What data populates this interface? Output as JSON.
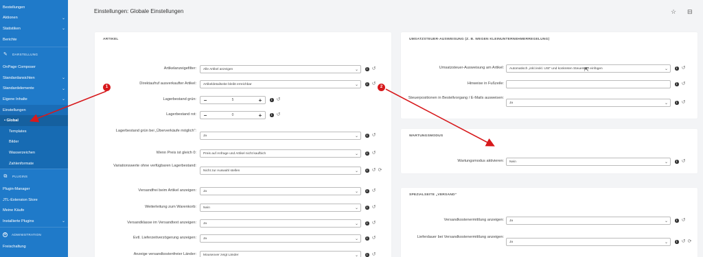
{
  "sidebar": {
    "items": [
      {
        "label": "Bestellungen",
        "chevron": false
      },
      {
        "label": "Aktionen",
        "chevron": true
      },
      {
        "label": "Statistiken",
        "chevron": true
      },
      {
        "label": "Berichte",
        "chevron": false
      }
    ],
    "section_darstellung": "DARSTELLUNG",
    "darstellung_items": [
      {
        "label": "OnPage Composer",
        "chevron": false
      },
      {
        "label": "Standardansichten",
        "chevron": true
      },
      {
        "label": "Standardelemente",
        "chevron": true
      },
      {
        "label": "Eigene Inhalte",
        "chevron": true
      },
      {
        "label": "Einstellungen",
        "chevron": false
      }
    ],
    "einstellungen_sub": [
      {
        "label": "• Global",
        "active": true
      },
      {
        "label": "Templates",
        "active": false
      },
      {
        "label": "Bilder",
        "active": false
      },
      {
        "label": "Wasserzeichen",
        "active": false
      },
      {
        "label": "Zahlenformate",
        "active": false
      }
    ],
    "section_plugins": "PLUGINS",
    "plugin_items": [
      {
        "label": "Plugin-Manager",
        "chevron": false
      },
      {
        "label": "JTL-Extension Store",
        "chevron": false
      },
      {
        "label": "Meine Käufe",
        "chevron": false
      },
      {
        "label": "Installierte Plugins",
        "chevron": true
      }
    ],
    "section_admin": "ADMINISTRATION",
    "admin_items": [
      {
        "label": "Freischaltung",
        "chevron": false
      }
    ]
  },
  "header": {
    "title": "Einstellungen: Globale Einstellungen",
    "star_icon": "star-icon",
    "help_icon": "help-icon"
  },
  "artikel": {
    "title": "ARTIKEL",
    "rows": [
      {
        "label": "Artikelanzeigefilter:",
        "type": "select",
        "value": "Alle Artikel anzeigen"
      },
      {
        "label": "Direktaufruf ausverkaufter Artikel:",
        "type": "select",
        "value": "Artikeldetailseite bleibt erreichbar"
      },
      {
        "label": "Lagerbestand grün:",
        "type": "stepper",
        "value": "5"
      },
      {
        "label": "Lagerbestand rot:",
        "type": "stepper",
        "value": "0"
      },
      {
        "label": "Lagerbestand grün bei „Überverkäufe möglich“:",
        "type": "select",
        "value": "Ja"
      },
      {
        "label": "Wenn Preis ist gleich 0:",
        "type": "select",
        "value": "Preis auf Anfrage und Artikel nicht kaufbich"
      },
      {
        "label": "Variationswerte ohne verfügbaren Lagerbestand:",
        "type": "select",
        "value": "Nicht zur Auswahl stellen"
      },
      {
        "label": "Versandfrei beim Artikel anzeigen:",
        "type": "select",
        "value": "Ja"
      },
      {
        "label": "Weiterleitung zum Warenkorb:",
        "type": "select",
        "value": "Nein"
      },
      {
        "label": "Versandklasse im Versandtext anzeigen:",
        "type": "select",
        "value": "Ja"
      },
      {
        "label": "Evtl. Lieferzeitverzögerung anzeigen:",
        "type": "select",
        "value": "Ja"
      },
      {
        "label": "Anzeige versandkostenfreier Länder:",
        "type": "select",
        "value": "Mouseover zeigt Länder"
      }
    ]
  },
  "ust": {
    "title": "UMSATZSTEUER-AUSWEISUNG (Z. B. WEGEN KLEINUNTERNEHMERREGELUNG)",
    "rows": [
      {
        "label": "Umsatzsteuer-Ausweisung am Artikel:",
        "type": "select",
        "value": "Automatisch „inkl./exkl. USt“ und konkreten Steuersatz einfügen"
      },
      {
        "label": "Hinweise in Fußzeile:",
        "type": "text",
        "value": ""
      },
      {
        "label": "Steuerpositionen in Bestellvorgang / E-Mails ausweisen:",
        "type": "select",
        "value": "Ja"
      }
    ]
  },
  "wartung": {
    "title": "WARTUNGSMODUS",
    "rows": [
      {
        "label": "Wartungsmodus aktivieren:",
        "type": "select",
        "value": "Nein"
      }
    ]
  },
  "versand": {
    "title": "SPEZIALSEITE „VERSAND“",
    "rows": [
      {
        "label": "Versandkostenermittlung anzeigen:",
        "type": "select",
        "value": "Ja"
      },
      {
        "label": "Lieferdauer bei Versandkostenermittlung anzeigen:",
        "type": "select",
        "value": "Ja"
      }
    ]
  },
  "annotations": {
    "badge1": "1",
    "badge2": "2",
    "color": "#d7191c"
  },
  "colors": {
    "sidebar": "#1f7ac9",
    "background": "#f3f4f6"
  }
}
